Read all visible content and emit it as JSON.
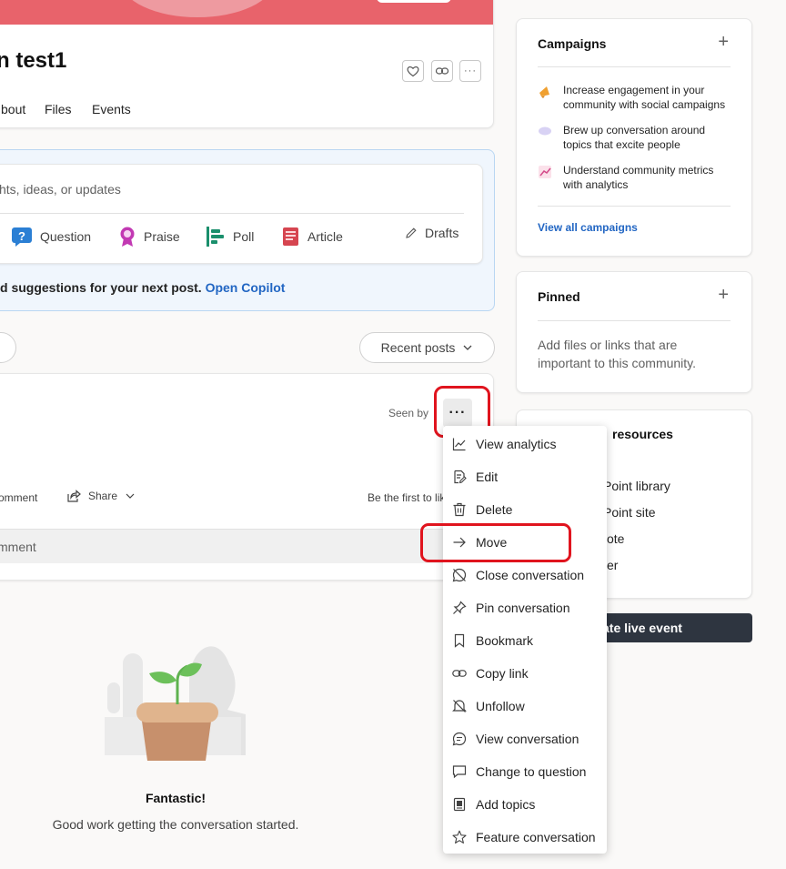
{
  "group": {
    "title": "n test1",
    "tabs": [
      "bout",
      "Files",
      "Events"
    ]
  },
  "composer": {
    "placeholder": "hts, ideas, or updates",
    "post_types": [
      "Question",
      "Praise",
      "Poll",
      "Article"
    ],
    "drafts_label": "Drafts",
    "copilot_prefix": "d suggestions for your next post.",
    "copilot_link": "Open Copilot"
  },
  "feed": {
    "sort_label": "Recent posts"
  },
  "post": {
    "seen_by": "Seen by",
    "more_icon": "···",
    "comment_label": "omment",
    "share_label": "Share",
    "first_like": "Be the first to lik",
    "comment_placeholder": "mment"
  },
  "empty_state": {
    "title": "Fantastic!",
    "message": "Good work getting the conversation started."
  },
  "sidebar": {
    "campaigns": {
      "title": "Campaigns",
      "items": [
        "Increase engagement in your community with social campaigns",
        "Brew up conversation around topics that excite people",
        "Understand community metrics with analytics"
      ],
      "view_all": "View all campaigns"
    },
    "pinned": {
      "title": "Pinned",
      "text": "Add files or links that are important to this community."
    },
    "resources": {
      "title": "resources",
      "items": [
        "Point library",
        "Point site",
        "ote",
        "er"
      ]
    },
    "live_event_label": "ate live event"
  },
  "context_menu": {
    "items": [
      {
        "label": "View analytics",
        "icon": "analytics-icon"
      },
      {
        "label": "Edit",
        "icon": "edit-icon"
      },
      {
        "label": "Delete",
        "icon": "delete-icon"
      },
      {
        "label": "Move",
        "icon": "arrow-right-icon"
      },
      {
        "label": "Close conversation",
        "icon": "close-conversation-icon"
      },
      {
        "label": "Pin conversation",
        "icon": "pin-icon"
      },
      {
        "label": "Bookmark",
        "icon": "bookmark-icon"
      },
      {
        "label": "Copy link",
        "icon": "link-icon"
      },
      {
        "label": "Unfollow",
        "icon": "unfollow-icon"
      },
      {
        "label": "View conversation",
        "icon": "conversation-icon"
      },
      {
        "label": "Change to question",
        "icon": "question-icon"
      },
      {
        "label": "Add topics",
        "icon": "topics-icon"
      },
      {
        "label": "Feature conversation",
        "icon": "star-icon"
      }
    ]
  },
  "colors": {
    "banner": "#e8636b",
    "accent_link": "#2266c3",
    "highlight": "#e0141e",
    "live_event_bg": "#2e3540"
  }
}
